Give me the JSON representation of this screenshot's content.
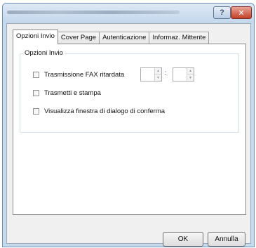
{
  "window": {
    "help_icon": "?",
    "close_icon": "✕"
  },
  "tabs": [
    "Opzioni Invio",
    "Cover Page",
    "Autenticazione",
    "Informaz. Mittente"
  ],
  "group": {
    "title": "Opzioni Invio",
    "options": [
      {
        "label": "Trasmissione FAX ritardata",
        "checked": false
      },
      {
        "label": "Trasmetti e stampa",
        "checked": false
      },
      {
        "label": "Visualizza finestra di dialogo di conferma",
        "checked": false
      }
    ],
    "time_separator": ":",
    "spin_up": "▲",
    "spin_down": "▼"
  },
  "buttons": {
    "ok": "OK",
    "cancel": "Annulla"
  }
}
